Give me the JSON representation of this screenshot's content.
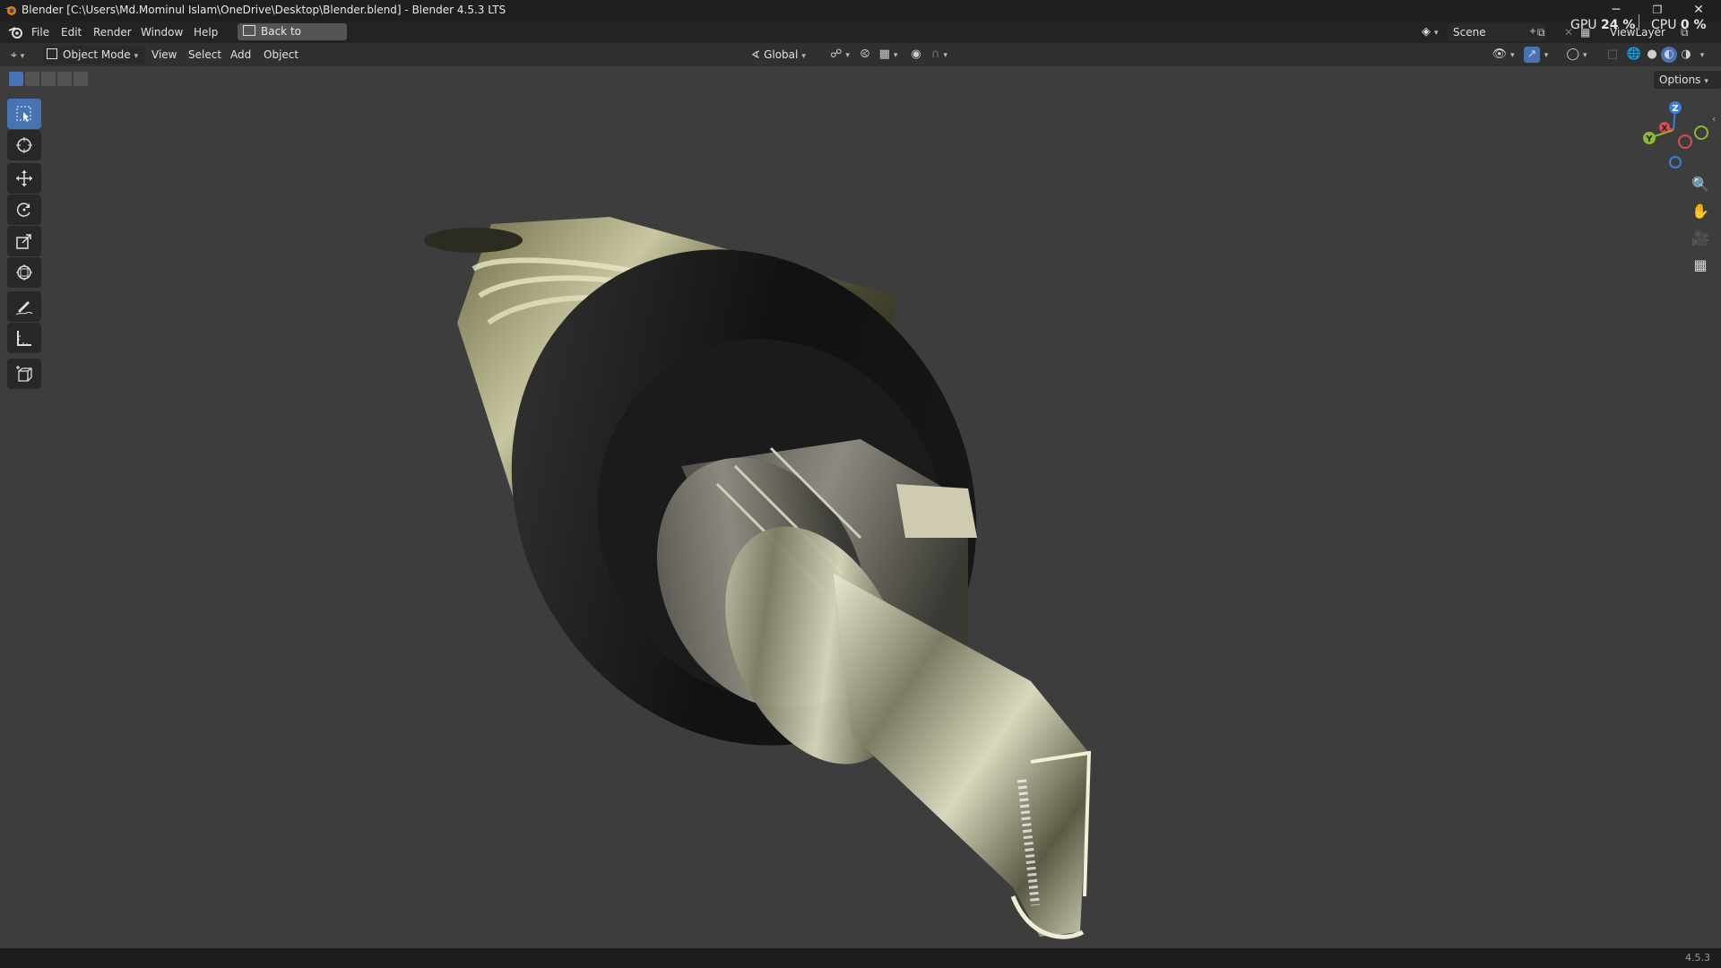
{
  "window": {
    "title": "Blender [C:\\Users\\Md.Mominul Islam\\OneDrive\\Desktop\\Blender.blend] - Blender 4.5.3 LTS",
    "controls": [
      "─",
      "❐",
      "✕"
    ]
  },
  "menubar": {
    "items": [
      "File",
      "Edit",
      "Render",
      "Window",
      "Help"
    ],
    "back_button": "Back to Previous",
    "gpu_label": "GPU",
    "gpu_value": "24 %",
    "cpu_label": "CPU",
    "cpu_value": "0 %",
    "scene": "Scene",
    "view_layer": "ViewLayer"
  },
  "header": {
    "mode": "Object Mode",
    "menus": [
      "View",
      "Select",
      "Add",
      "Object"
    ],
    "transform_orientation": "Global",
    "options": "Options"
  },
  "toolbar": {
    "tools": [
      "select-box-tool",
      "cursor-tool",
      "move-tool",
      "rotate-tool",
      "scale-tool",
      "transform-tool",
      "annotate-tool",
      "measure-tool",
      "add-cube-tool"
    ],
    "active": "select-box-tool"
  },
  "gizmo": {
    "axes": {
      "z": "Z",
      "y": "Y",
      "x": "X"
    },
    "colors": {
      "x": "#d94b56",
      "y": "#8bba32",
      "z": "#3b7fd6"
    }
  },
  "statusbar": {
    "version": "4.5.3"
  },
  "colors": {
    "accent": "#4772b3",
    "viewport_bg": "#3d3d3d"
  }
}
